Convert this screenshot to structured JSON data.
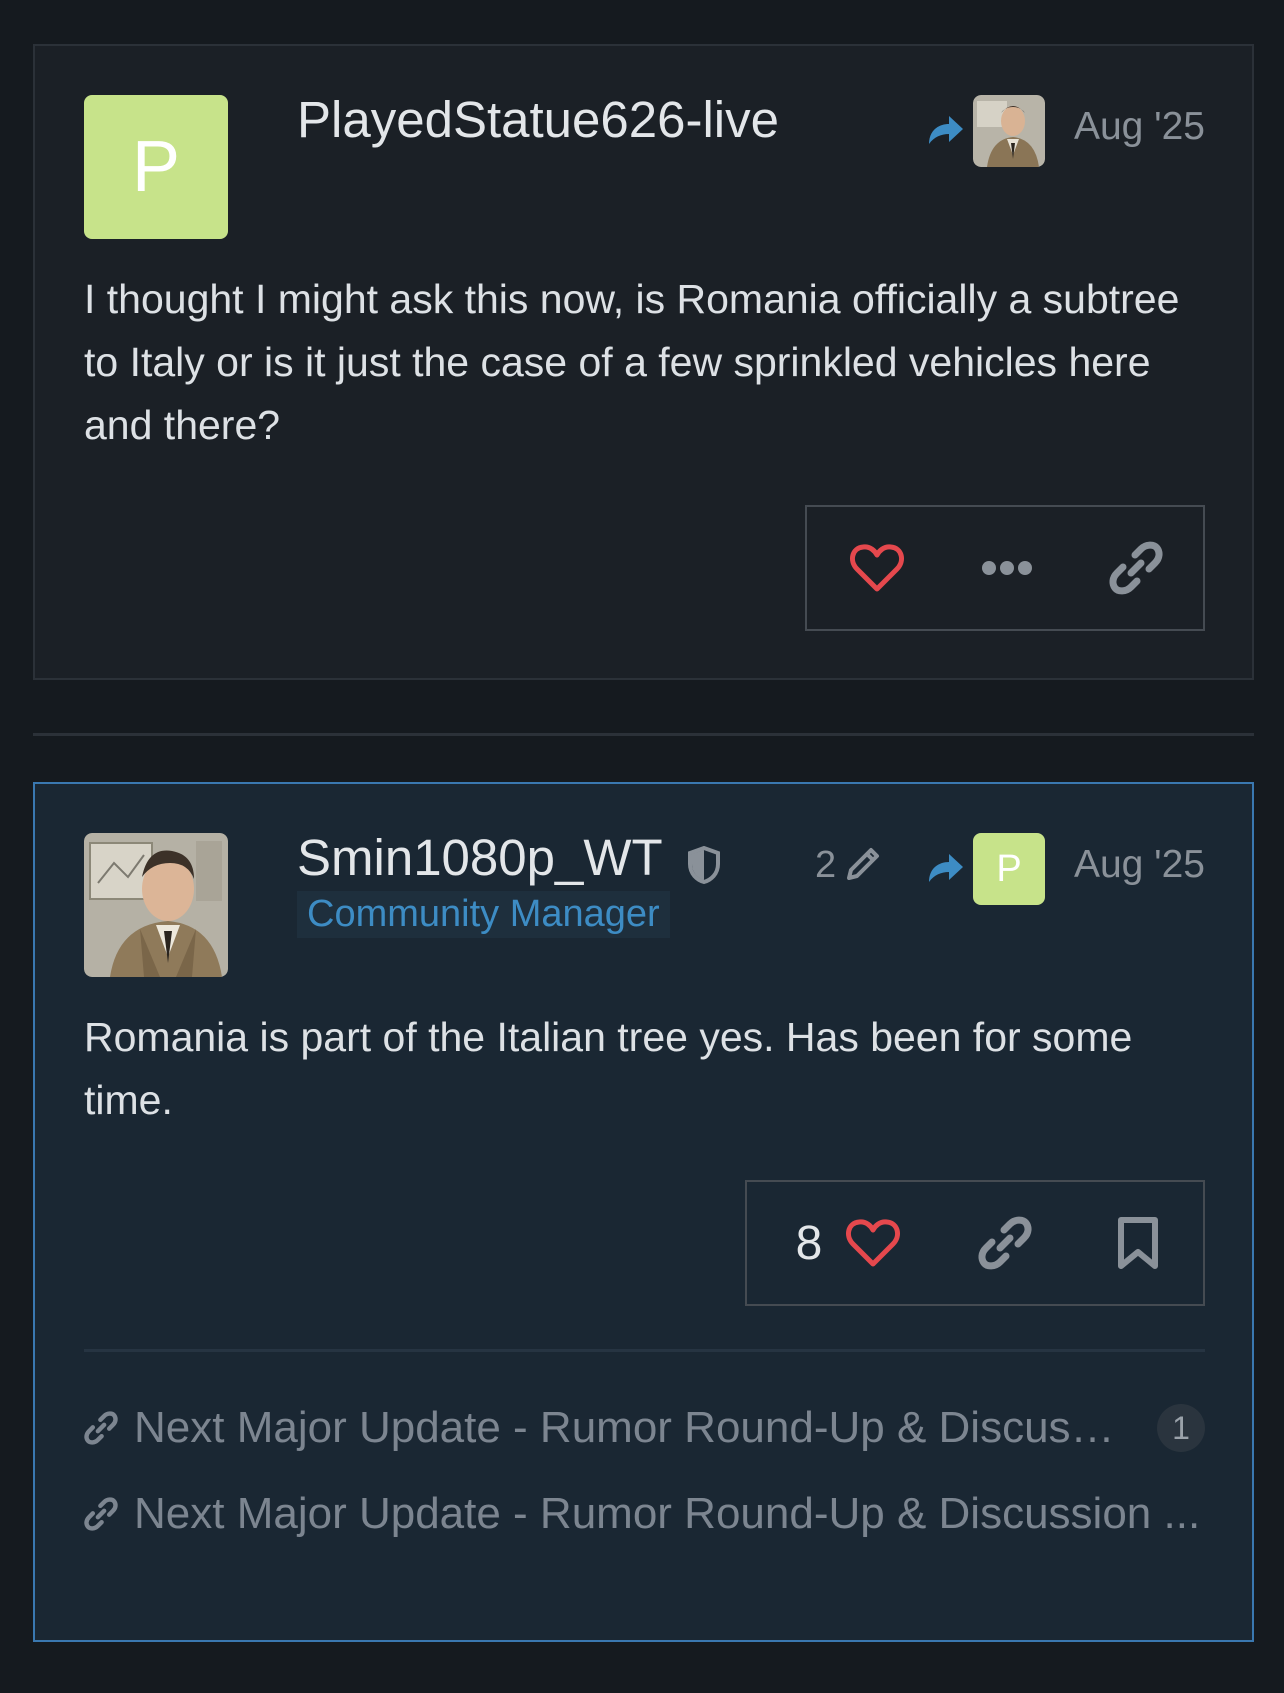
{
  "posts": [
    {
      "username": "PlayedStatue626-live",
      "avatar_letter": "P",
      "avatar_color": "#c7e38a",
      "date": "Aug '25",
      "reply_to_avatar": "person-portrait",
      "body": "I thought I might ask this now, is Romania officially a subtree to Italy or is it just the case of a few sprinkled vehicles here and there?",
      "actions": [
        "heart-icon",
        "more-icon",
        "link-icon"
      ]
    },
    {
      "username": "Smin1080p_WT",
      "user_title": "Community Manager",
      "edit_count": "2",
      "reply_to_letter": "P",
      "date": "Aug '25",
      "body": "Romania is part of the Italian tree yes. Has been for some time.",
      "like_count": "8",
      "actions": [
        "heart-icon",
        "link-icon",
        "bookmark-icon"
      ],
      "links": [
        {
          "label": "Next Major Update - Rumor Round-Up & Discussi...",
          "count": "1"
        },
        {
          "label": "Next Major Update - Rumor Round-Up & Discussion ..."
        }
      ]
    }
  ],
  "colors": {
    "accent_blue": "#3a78b0",
    "heart_red": "#e5484d",
    "title_blue": "#3d8cc4"
  }
}
